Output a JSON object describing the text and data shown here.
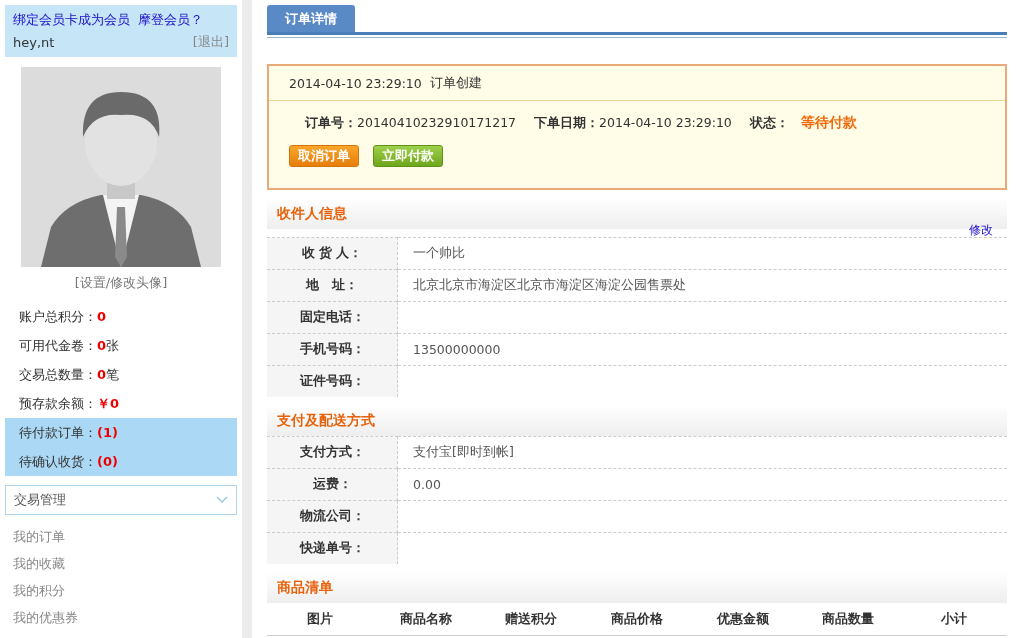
{
  "sidebar": {
    "member_links": [
      "绑定会员卡成为会员",
      "摩登会员？"
    ],
    "username": "hey,nt",
    "logout": "[退出]",
    "avatar_caption": "[设置/修改头像]",
    "stats": [
      {
        "label": "账户总积分：",
        "value": "0",
        "highlighted": false
      },
      {
        "label": "可用代金卷：",
        "value": "0",
        "unit": "张",
        "highlighted": false
      },
      {
        "label": "交易总数量：",
        "value": "0",
        "unit": "笔",
        "highlighted": false
      },
      {
        "label": "预存款余额：",
        "value": "￥0",
        "highlighted": false
      },
      {
        "label": "待付款订单：",
        "value": "(1)",
        "highlighted": true
      },
      {
        "label": "待确认收货：",
        "value": "(0)",
        "highlighted": true
      }
    ],
    "menu": {
      "title": "交易管理",
      "expanded": true,
      "items": [
        "我的订单",
        "我的收藏",
        "我的积分",
        "我的优惠券"
      ]
    }
  },
  "main": {
    "tab": {
      "label": "订单详情",
      "selected": true
    },
    "order": {
      "log": [
        {
          "time": "2014-04-10 23:29:10",
          "event": "订单创建"
        }
      ],
      "fields": [
        {
          "label": "订单号：",
          "value": "20140410232910171217"
        },
        {
          "label": "下单日期：",
          "value": "2014-04-10 23:29:10"
        }
      ],
      "status_label": "状态：",
      "status": "等待付款",
      "buttons": [
        {
          "label": "取消订单",
          "kind": "cancel"
        },
        {
          "label": "立即付款",
          "kind": "pay"
        }
      ]
    },
    "sections": [
      {
        "title": "收件人信息",
        "action": "修改",
        "rows": [
          {
            "label": "收 货 人：",
            "value": "一个帅比"
          },
          {
            "label": "地　址：",
            "value": "北京北京市海淀区北京市海淀区海淀公园售票处"
          },
          {
            "label": "固定电话："
          },
          {
            "label": "手机号码：",
            "value": "13500000000"
          },
          {
            "label": "证件号码："
          }
        ]
      },
      {
        "title": "支付及配送方式",
        "rows": [
          {
            "label": "支付方式：",
            "value": "支付宝[即时到帐]"
          },
          {
            "label": "运费：",
            "value": "0.00"
          },
          {
            "label": "物流公司："
          },
          {
            "label": "快递单号："
          }
        ]
      },
      {
        "title": "商品清单",
        "columns": [
          "图片",
          "商品名称",
          "赠送积分",
          "商品价格",
          "优惠金额",
          "商品数量",
          "小计"
        ]
      }
    ]
  }
}
